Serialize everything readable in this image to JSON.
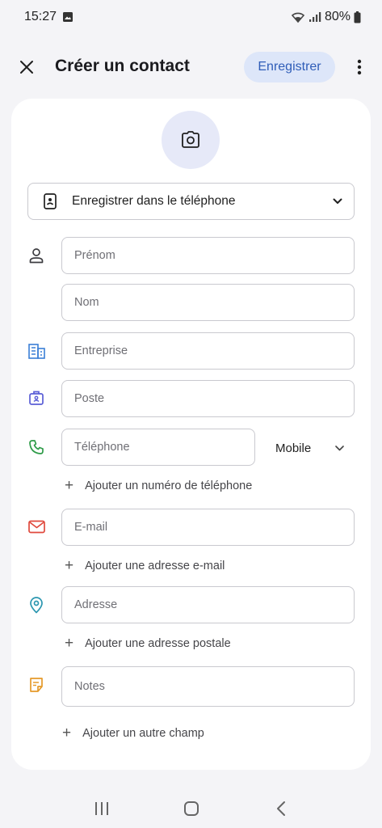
{
  "status_bar": {
    "time": "15:27",
    "battery": "80%",
    "icons": [
      "image-notification-icon",
      "wifi-icon",
      "signal-icon",
      "battery-icon"
    ]
  },
  "app_bar": {
    "title": "Créer un contact",
    "save_label": "Enregistrer",
    "accent_color": "#2f5db8",
    "button_bg": "#dde6f9"
  },
  "account": {
    "label": "Enregistrer dans le téléphone"
  },
  "fields": {
    "first_name": {
      "placeholder": "Prénom",
      "value": ""
    },
    "last_name": {
      "placeholder": "Nom",
      "value": ""
    },
    "company": {
      "placeholder": "Entreprise",
      "value": ""
    },
    "job_title": {
      "placeholder": "Poste",
      "value": ""
    },
    "phone": {
      "placeholder": "Téléphone",
      "value": "",
      "type": "Mobile"
    },
    "email": {
      "placeholder": "E-mail",
      "value": ""
    },
    "address": {
      "placeholder": "Adresse",
      "value": ""
    },
    "notes": {
      "placeholder": "Notes",
      "value": ""
    }
  },
  "links": {
    "add_phone": "Ajouter un numéro de téléphone",
    "add_email": "Ajouter une adresse e-mail",
    "add_address": "Ajouter une adresse postale",
    "add_field": "Ajouter un autre champ",
    "plus": "+"
  },
  "icon_colors": {
    "person": "#3c3c40",
    "company": "#3a7fd6",
    "job": "#5b5fd6",
    "phone": "#2e9b48",
    "email": "#e04a3e",
    "address": "#2c97b0",
    "notes": "#e59a2a"
  }
}
